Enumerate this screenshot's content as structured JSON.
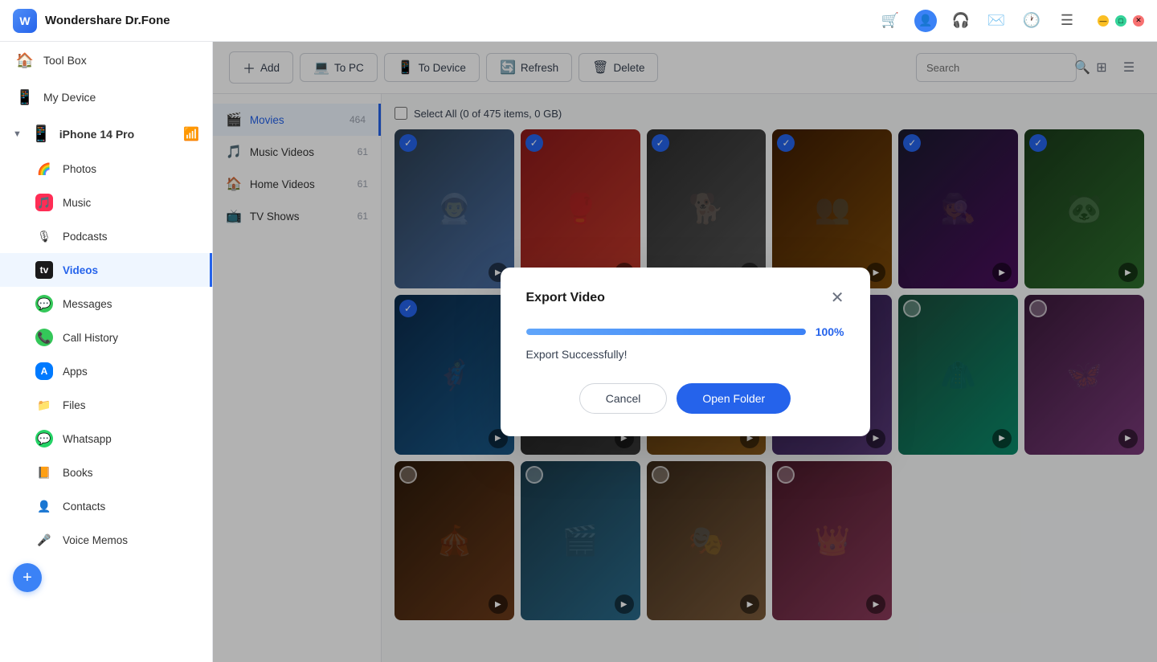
{
  "app": {
    "title": "Wondershare Dr.Fone",
    "logo_text": "W"
  },
  "titlebar": {
    "icons": [
      "cart",
      "avatar",
      "headset",
      "mail",
      "history",
      "list"
    ],
    "win_controls": [
      "minimize",
      "maximize",
      "close"
    ]
  },
  "sidebar": {
    "tool_box": "Tool Box",
    "my_device": "My Device",
    "device": {
      "name": "iPhone 14 Pro"
    },
    "items": [
      {
        "id": "photos",
        "label": "Photos",
        "icon": "🌈",
        "color": "#ff9500"
      },
      {
        "id": "music",
        "label": "Music",
        "icon": "🎵",
        "color": "#ff2d55"
      },
      {
        "id": "podcasts",
        "label": "Podcasts",
        "icon": "🎙",
        "color": "#9b59b6"
      },
      {
        "id": "videos",
        "label": "Videos",
        "icon": "📺",
        "color": "#1a1a1a",
        "active": true
      },
      {
        "id": "messages",
        "label": "Messages",
        "icon": "💬",
        "color": "#34c759"
      },
      {
        "id": "callhistory",
        "label": "Call History",
        "icon": "📞",
        "color": "#34c759"
      },
      {
        "id": "apps",
        "label": "Apps",
        "icon": "🅐",
        "color": "#007aff"
      },
      {
        "id": "files",
        "label": "Files",
        "icon": "📁",
        "color": "#007aff"
      },
      {
        "id": "whatsapp",
        "label": "Whatsapp",
        "icon": "💚",
        "color": "#25d366"
      },
      {
        "id": "books",
        "label": "Books",
        "icon": "📙",
        "color": "#ff9500"
      },
      {
        "id": "contacts",
        "label": "Contacts",
        "icon": "👤",
        "color": "#6b7280"
      },
      {
        "id": "voicememos",
        "label": "Voice Memos",
        "icon": "🎤",
        "color": "#1a1a1a"
      }
    ]
  },
  "toolbar": {
    "add_label": "Add",
    "to_pc_label": "To PC",
    "to_device_label": "To Device",
    "refresh_label": "Refresh",
    "delete_label": "Delete",
    "search_placeholder": "Search"
  },
  "categories": [
    {
      "id": "movies",
      "label": "Movies",
      "count": 464,
      "active": true
    },
    {
      "id": "music_videos",
      "label": "Music Videos",
      "count": 61
    },
    {
      "id": "home_videos",
      "label": "Home Videos",
      "count": 61
    },
    {
      "id": "tv_shows",
      "label": "TV Shows",
      "count": 61
    }
  ],
  "select_all": {
    "label": "Select All (0 of 475 items, 0 GB)"
  },
  "thumbnails": [
    {
      "id": 1,
      "cls": "t1",
      "checked": true
    },
    {
      "id": 2,
      "cls": "t2",
      "checked": true
    },
    {
      "id": 3,
      "cls": "t3",
      "checked": true
    },
    {
      "id": 4,
      "cls": "t4",
      "checked": true
    },
    {
      "id": 5,
      "cls": "t5",
      "checked": true
    },
    {
      "id": 6,
      "cls": "t6",
      "checked": true
    },
    {
      "id": 7,
      "cls": "t7",
      "checked": true
    },
    {
      "id": 8,
      "cls": "t8",
      "checked": false
    },
    {
      "id": 9,
      "cls": "t9",
      "checked": false
    },
    {
      "id": 10,
      "cls": "t10",
      "checked": true
    },
    {
      "id": 11,
      "cls": "t11",
      "checked": false
    },
    {
      "id": 12,
      "cls": "t12",
      "checked": false
    },
    {
      "id": 13,
      "cls": "t13",
      "checked": false
    },
    {
      "id": 14,
      "cls": "t14",
      "checked": false
    },
    {
      "id": 15,
      "cls": "t15",
      "checked": false
    },
    {
      "id": 16,
      "cls": "t16",
      "checked": false
    }
  ],
  "dialog": {
    "title": "Export Video",
    "progress": 100,
    "progress_label": "100%",
    "success_text": "Export Successfully!",
    "cancel_label": "Cancel",
    "open_folder_label": "Open Folder"
  }
}
